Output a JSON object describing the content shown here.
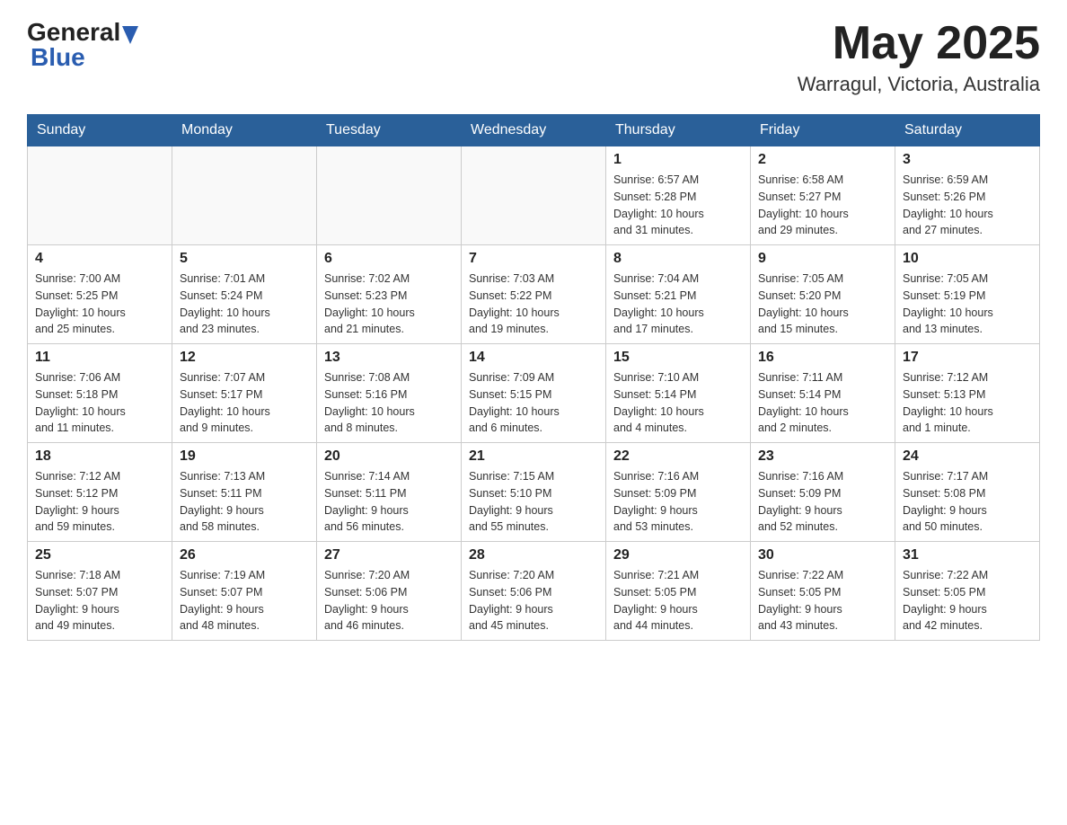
{
  "header": {
    "logo_general": "General",
    "logo_blue": "Blue",
    "month_title": "May 2025",
    "location": "Warragul, Victoria, Australia"
  },
  "weekdays": [
    "Sunday",
    "Monday",
    "Tuesday",
    "Wednesday",
    "Thursday",
    "Friday",
    "Saturday"
  ],
  "weeks": [
    [
      {
        "day": "",
        "info": ""
      },
      {
        "day": "",
        "info": ""
      },
      {
        "day": "",
        "info": ""
      },
      {
        "day": "",
        "info": ""
      },
      {
        "day": "1",
        "info": "Sunrise: 6:57 AM\nSunset: 5:28 PM\nDaylight: 10 hours\nand 31 minutes."
      },
      {
        "day": "2",
        "info": "Sunrise: 6:58 AM\nSunset: 5:27 PM\nDaylight: 10 hours\nand 29 minutes."
      },
      {
        "day": "3",
        "info": "Sunrise: 6:59 AM\nSunset: 5:26 PM\nDaylight: 10 hours\nand 27 minutes."
      }
    ],
    [
      {
        "day": "4",
        "info": "Sunrise: 7:00 AM\nSunset: 5:25 PM\nDaylight: 10 hours\nand 25 minutes."
      },
      {
        "day": "5",
        "info": "Sunrise: 7:01 AM\nSunset: 5:24 PM\nDaylight: 10 hours\nand 23 minutes."
      },
      {
        "day": "6",
        "info": "Sunrise: 7:02 AM\nSunset: 5:23 PM\nDaylight: 10 hours\nand 21 minutes."
      },
      {
        "day": "7",
        "info": "Sunrise: 7:03 AM\nSunset: 5:22 PM\nDaylight: 10 hours\nand 19 minutes."
      },
      {
        "day": "8",
        "info": "Sunrise: 7:04 AM\nSunset: 5:21 PM\nDaylight: 10 hours\nand 17 minutes."
      },
      {
        "day": "9",
        "info": "Sunrise: 7:05 AM\nSunset: 5:20 PM\nDaylight: 10 hours\nand 15 minutes."
      },
      {
        "day": "10",
        "info": "Sunrise: 7:05 AM\nSunset: 5:19 PM\nDaylight: 10 hours\nand 13 minutes."
      }
    ],
    [
      {
        "day": "11",
        "info": "Sunrise: 7:06 AM\nSunset: 5:18 PM\nDaylight: 10 hours\nand 11 minutes."
      },
      {
        "day": "12",
        "info": "Sunrise: 7:07 AM\nSunset: 5:17 PM\nDaylight: 10 hours\nand 9 minutes."
      },
      {
        "day": "13",
        "info": "Sunrise: 7:08 AM\nSunset: 5:16 PM\nDaylight: 10 hours\nand 8 minutes."
      },
      {
        "day": "14",
        "info": "Sunrise: 7:09 AM\nSunset: 5:15 PM\nDaylight: 10 hours\nand 6 minutes."
      },
      {
        "day": "15",
        "info": "Sunrise: 7:10 AM\nSunset: 5:14 PM\nDaylight: 10 hours\nand 4 minutes."
      },
      {
        "day": "16",
        "info": "Sunrise: 7:11 AM\nSunset: 5:14 PM\nDaylight: 10 hours\nand 2 minutes."
      },
      {
        "day": "17",
        "info": "Sunrise: 7:12 AM\nSunset: 5:13 PM\nDaylight: 10 hours\nand 1 minute."
      }
    ],
    [
      {
        "day": "18",
        "info": "Sunrise: 7:12 AM\nSunset: 5:12 PM\nDaylight: 9 hours\nand 59 minutes."
      },
      {
        "day": "19",
        "info": "Sunrise: 7:13 AM\nSunset: 5:11 PM\nDaylight: 9 hours\nand 58 minutes."
      },
      {
        "day": "20",
        "info": "Sunrise: 7:14 AM\nSunset: 5:11 PM\nDaylight: 9 hours\nand 56 minutes."
      },
      {
        "day": "21",
        "info": "Sunrise: 7:15 AM\nSunset: 5:10 PM\nDaylight: 9 hours\nand 55 minutes."
      },
      {
        "day": "22",
        "info": "Sunrise: 7:16 AM\nSunset: 5:09 PM\nDaylight: 9 hours\nand 53 minutes."
      },
      {
        "day": "23",
        "info": "Sunrise: 7:16 AM\nSunset: 5:09 PM\nDaylight: 9 hours\nand 52 minutes."
      },
      {
        "day": "24",
        "info": "Sunrise: 7:17 AM\nSunset: 5:08 PM\nDaylight: 9 hours\nand 50 minutes."
      }
    ],
    [
      {
        "day": "25",
        "info": "Sunrise: 7:18 AM\nSunset: 5:07 PM\nDaylight: 9 hours\nand 49 minutes."
      },
      {
        "day": "26",
        "info": "Sunrise: 7:19 AM\nSunset: 5:07 PM\nDaylight: 9 hours\nand 48 minutes."
      },
      {
        "day": "27",
        "info": "Sunrise: 7:20 AM\nSunset: 5:06 PM\nDaylight: 9 hours\nand 46 minutes."
      },
      {
        "day": "28",
        "info": "Sunrise: 7:20 AM\nSunset: 5:06 PM\nDaylight: 9 hours\nand 45 minutes."
      },
      {
        "day": "29",
        "info": "Sunrise: 7:21 AM\nSunset: 5:05 PM\nDaylight: 9 hours\nand 44 minutes."
      },
      {
        "day": "30",
        "info": "Sunrise: 7:22 AM\nSunset: 5:05 PM\nDaylight: 9 hours\nand 43 minutes."
      },
      {
        "day": "31",
        "info": "Sunrise: 7:22 AM\nSunset: 5:05 PM\nDaylight: 9 hours\nand 42 minutes."
      }
    ]
  ]
}
